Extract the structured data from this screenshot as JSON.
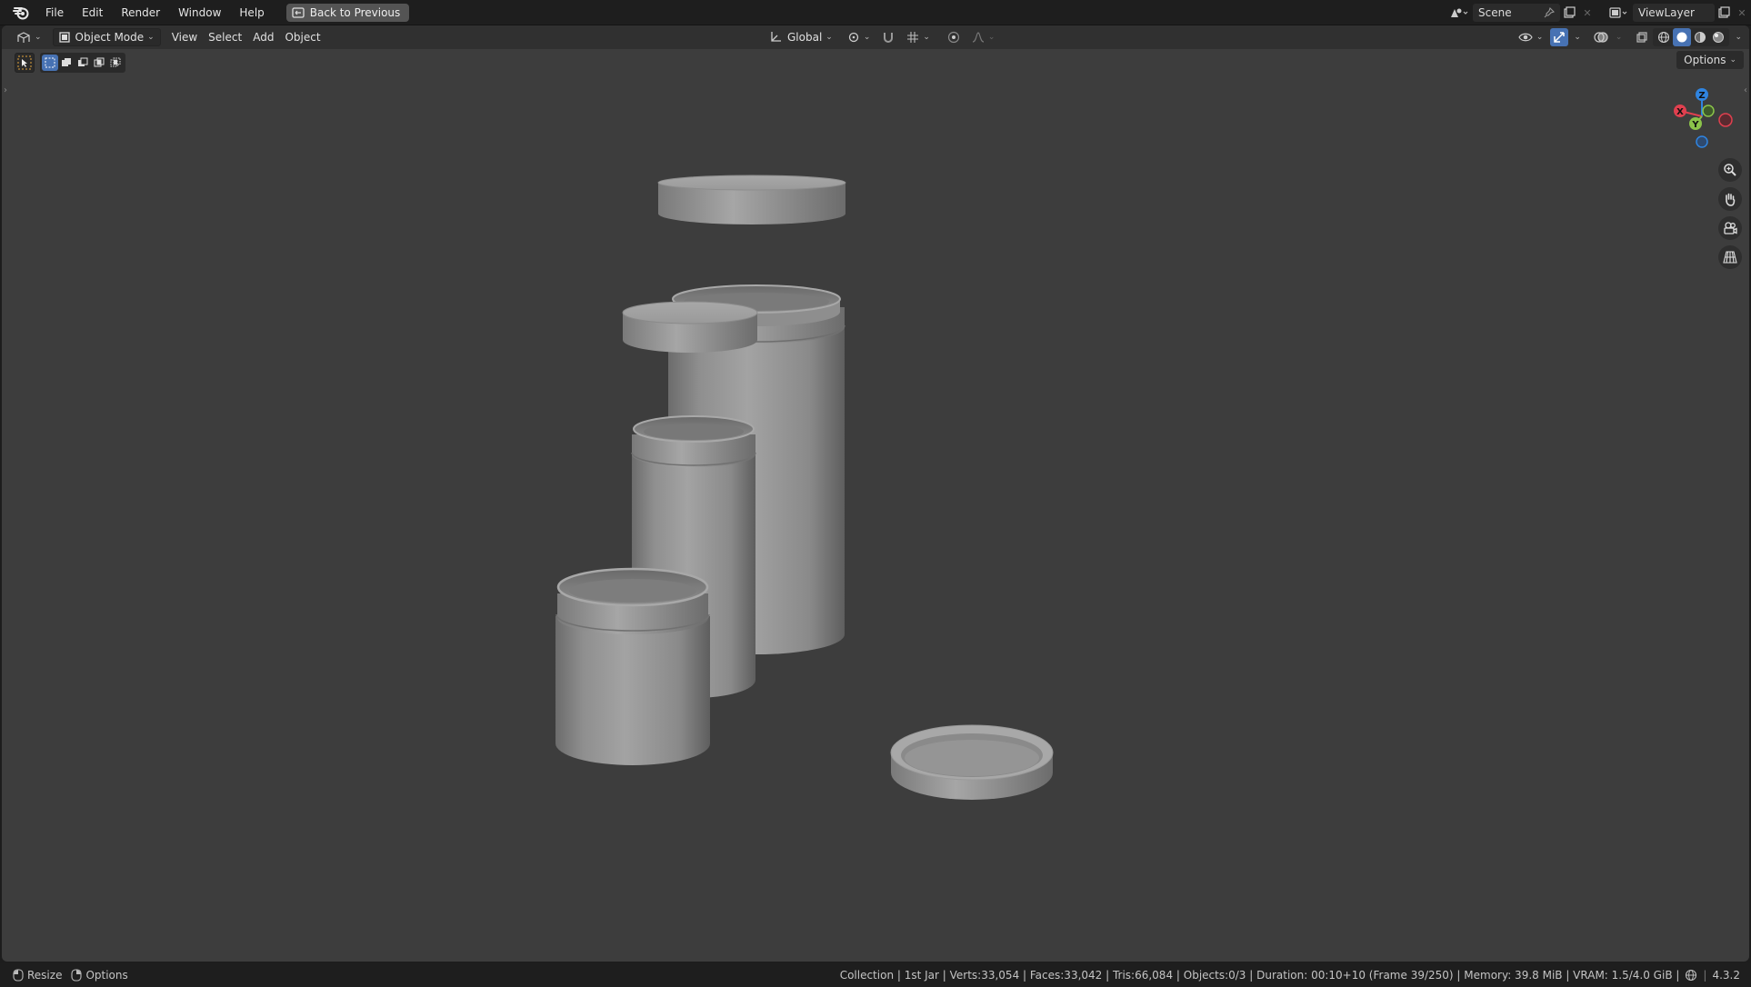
{
  "topbar": {
    "menus": [
      "File",
      "Edit",
      "Render",
      "Window",
      "Help"
    ],
    "back_button": "Back to Previous",
    "scene_name": "Scene",
    "view_layer": "ViewLayer"
  },
  "viewport_header": {
    "mode": "Object Mode",
    "menus": [
      "View",
      "Select",
      "Add",
      "Object"
    ],
    "transform_orientation": "Global",
    "options_label": "Options"
  },
  "gizmo": {
    "axes": [
      "Z",
      "X",
      "Y"
    ],
    "colors": {
      "x": "#e0404f",
      "y": "#8bc34a",
      "z": "#2f84e0"
    }
  },
  "navigation_tools": [
    "zoom-icon",
    "pan-hand-icon",
    "camera-icon",
    "perspective-grid-icon"
  ],
  "scene_objects": [
    "Floating Lid",
    "Tall Jar",
    "Small Lid",
    "Medium Jar",
    "Short Jar",
    "Open Lid"
  ],
  "statusbar": {
    "resize_label": "Resize",
    "options_label": "Options",
    "stats": "Collection | 1st Jar | Verts:33,054 | Faces:33,042 | Tris:66,084 | Objects:0/3 | Duration: 00:10+10 (Frame 39/250) | Memory: 39.8 MiB | VRAM: 1.5/4.0 GiB |",
    "version": "4.3.2"
  },
  "colors": {
    "viewport_bg": "#3d3d3d",
    "header_bg": "#303030",
    "accent": "#4772b3",
    "topbar_bg": "#1e1e1e"
  }
}
